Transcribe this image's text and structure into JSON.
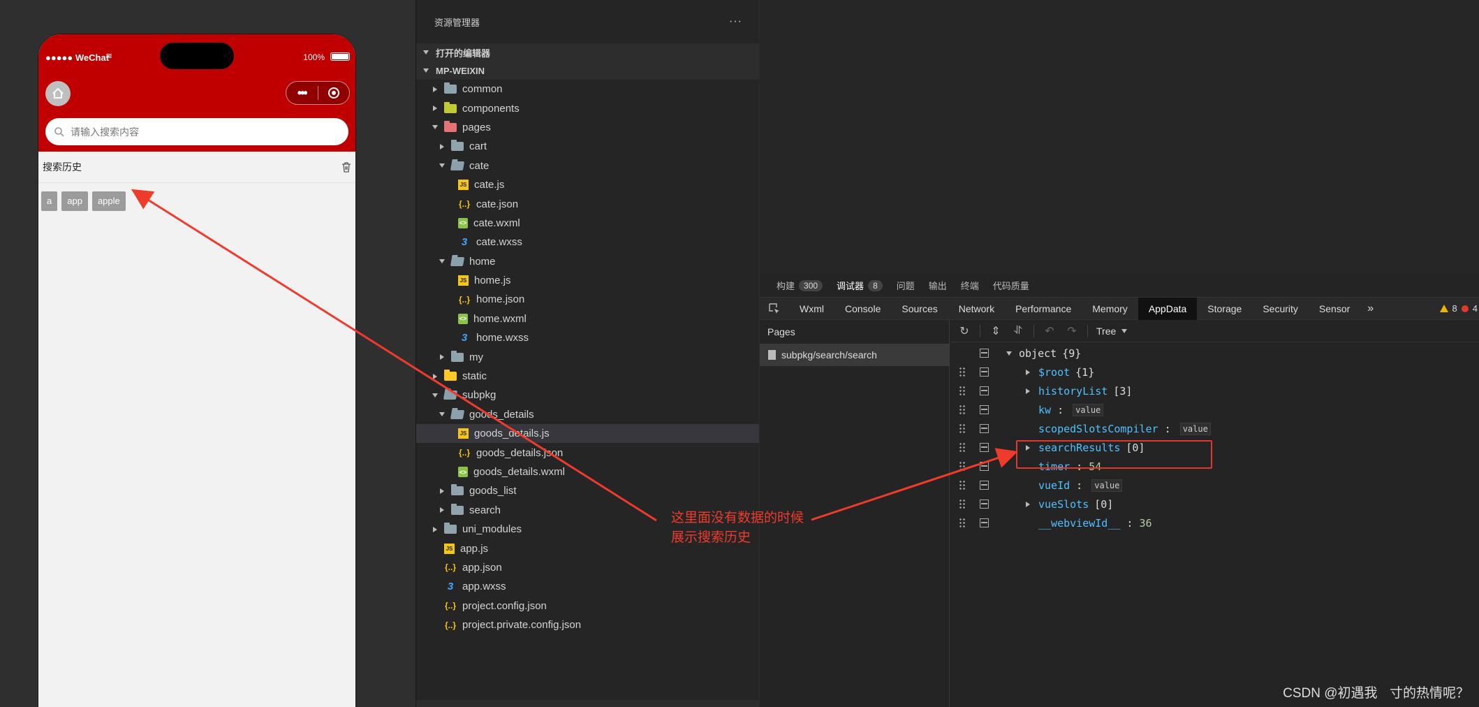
{
  "simulator": {
    "status_left": "●●●●● WeChat",
    "status_right": "100%",
    "search_placeholder": "请输入搜索内容",
    "history_title": "搜索历史",
    "history_tags": [
      "a",
      "app",
      "apple"
    ]
  },
  "explorer": {
    "title": "资源管理器",
    "more": "···",
    "open_editors": "打开的编辑器",
    "project": "MP-WEIXIN",
    "tree": [
      {
        "label": "common",
        "depth": 0,
        "kind": "folder",
        "state": "closed"
      },
      {
        "label": "components",
        "depth": 0,
        "kind": "folder-components",
        "state": "closed"
      },
      {
        "label": "pages",
        "depth": 0,
        "kind": "folder-pages",
        "state": "open"
      },
      {
        "label": "cart",
        "depth": 1,
        "kind": "folder",
        "state": "closed"
      },
      {
        "label": "cate",
        "depth": 1,
        "kind": "folder-open",
        "state": "open"
      },
      {
        "label": "cate.js",
        "depth": 2,
        "kind": "js"
      },
      {
        "label": "cate.json",
        "depth": 2,
        "kind": "json"
      },
      {
        "label": "cate.wxml",
        "depth": 2,
        "kind": "wxml"
      },
      {
        "label": "cate.wxss",
        "depth": 2,
        "kind": "wxss"
      },
      {
        "label": "home",
        "depth": 1,
        "kind": "folder-open",
        "state": "open"
      },
      {
        "label": "home.js",
        "depth": 2,
        "kind": "js"
      },
      {
        "label": "home.json",
        "depth": 2,
        "kind": "json"
      },
      {
        "label": "home.wxml",
        "depth": 2,
        "kind": "wxml"
      },
      {
        "label": "home.wxss",
        "depth": 2,
        "kind": "wxss"
      },
      {
        "label": "my",
        "depth": 1,
        "kind": "folder",
        "state": "closed"
      },
      {
        "label": "static",
        "depth": 0,
        "kind": "folder-static",
        "state": "closed"
      },
      {
        "label": "subpkg",
        "depth": 0,
        "kind": "folder-open",
        "state": "open"
      },
      {
        "label": "goods_details",
        "depth": 1,
        "kind": "folder-open",
        "state": "open"
      },
      {
        "label": "goods_details.js",
        "depth": 2,
        "kind": "js",
        "selected": true
      },
      {
        "label": "goods_details.json",
        "depth": 2,
        "kind": "json"
      },
      {
        "label": "goods_details.wxml",
        "depth": 2,
        "kind": "wxml"
      },
      {
        "label": "goods_list",
        "depth": 1,
        "kind": "folder",
        "state": "closed"
      },
      {
        "label": "search",
        "depth": 1,
        "kind": "folder",
        "state": "closed"
      },
      {
        "label": "uni_modules",
        "depth": 0,
        "kind": "folder",
        "state": "closed"
      },
      {
        "label": "app.js",
        "depth": 0,
        "kind": "js"
      },
      {
        "label": "app.json",
        "depth": 0,
        "kind": "json"
      },
      {
        "label": "app.wxss",
        "depth": 0,
        "kind": "wxss"
      },
      {
        "label": "project.config.json",
        "depth": 0,
        "kind": "json"
      },
      {
        "label": "project.private.config.json",
        "depth": 0,
        "kind": "json"
      }
    ]
  },
  "devtools": {
    "top_tabs": [
      {
        "label": "构建",
        "count": "300"
      },
      {
        "label": "调试器",
        "count": "8",
        "active": true
      },
      {
        "label": "问题"
      },
      {
        "label": "输出"
      },
      {
        "label": "终端"
      },
      {
        "label": "代码质量"
      }
    ],
    "panel_tabs": [
      "Wxml",
      "Console",
      "Sources",
      "Network",
      "Performance",
      "Memory",
      "AppData",
      "Storage",
      "Security",
      "Sensor"
    ],
    "active_panel": "AppData",
    "more_tabs": "»",
    "warnings": "8",
    "errors": "4",
    "pages_label": "Pages",
    "page_item": "subpkg/search/search",
    "tree_mode": "Tree",
    "appdata": [
      {
        "key": "object",
        "suffix": "{9}",
        "expander": "down",
        "root": true
      },
      {
        "key": "$root",
        "suffix": "{1}",
        "expander": "right"
      },
      {
        "key": "historyList",
        "suffix": "[3]",
        "expander": "right"
      },
      {
        "key": "kw",
        "sep": " : ",
        "chip": "value"
      },
      {
        "key": "scopedSlotsCompiler",
        "sep": " : ",
        "chip": "value"
      },
      {
        "key": "searchResults",
        "suffix": "[0]",
        "expander": "right",
        "highlight": true
      },
      {
        "key": "timer",
        "sep": " : ",
        "num": "54"
      },
      {
        "key": "vueId",
        "sep": " : ",
        "chip": "value"
      },
      {
        "key": "vueSlots",
        "suffix": "[0]",
        "expander": "right"
      },
      {
        "key": "__webviewId__",
        "sep": " : ",
        "num": "36"
      }
    ]
  },
  "annotation": {
    "line1": "这里面没有数据的时候",
    "line2": "展示搜索历史",
    "color": "#ee3b2b"
  },
  "watermark": "CSDN @初遇我ㅤ寸的热情呢？",
  "colors": {
    "header_red": "#c00000",
    "key_blue": "#4fc1ff",
    "highlight_red": "#e3372b"
  }
}
